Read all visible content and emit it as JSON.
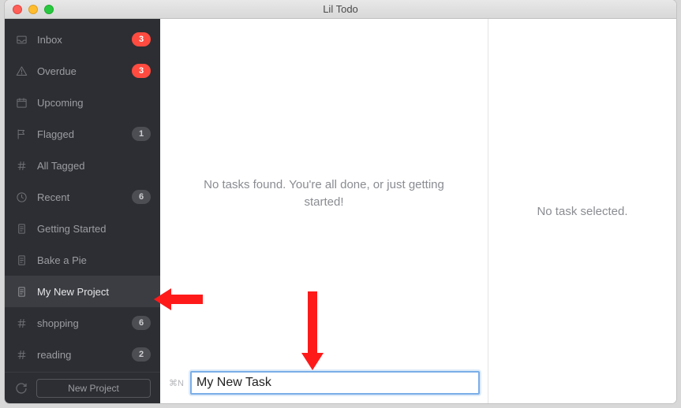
{
  "window": {
    "title": "Lil Todo"
  },
  "sidebar": {
    "items": [
      {
        "id": "inbox",
        "label": "Inbox",
        "icon": "inbox",
        "badge": "3",
        "badgeStyle": "red"
      },
      {
        "id": "overdue",
        "label": "Overdue",
        "icon": "warning",
        "badge": "3",
        "badgeStyle": "red"
      },
      {
        "id": "upcoming",
        "label": "Upcoming",
        "icon": "calendar",
        "badge": null
      },
      {
        "id": "flagged",
        "label": "Flagged",
        "icon": "flag",
        "badge": "1",
        "badgeStyle": "gray"
      },
      {
        "id": "all-tagged",
        "label": "All Tagged",
        "icon": "hash",
        "badge": null
      },
      {
        "id": "recent",
        "label": "Recent",
        "icon": "clock",
        "badge": "6",
        "badgeStyle": "gray"
      },
      {
        "id": "getting-started",
        "label": "Getting Started",
        "icon": "doc",
        "badge": null
      },
      {
        "id": "bake-a-pie",
        "label": "Bake a Pie",
        "icon": "doc",
        "badge": null
      },
      {
        "id": "my-new-project",
        "label": "My New Project",
        "icon": "doc",
        "badge": null,
        "selected": true
      },
      {
        "id": "shopping",
        "label": "shopping",
        "icon": "hash",
        "badge": "6",
        "badgeStyle": "gray"
      },
      {
        "id": "reading",
        "label": "reading",
        "icon": "hash",
        "badge": "2",
        "badgeStyle": "gray"
      }
    ],
    "new_project_label": "New Project"
  },
  "main": {
    "empty_message": "No tasks found. You're all done, or just getting started!",
    "shortcut_hint": "⌘N",
    "task_input_value": "My New Task"
  },
  "detail": {
    "empty_message": "No task selected."
  }
}
